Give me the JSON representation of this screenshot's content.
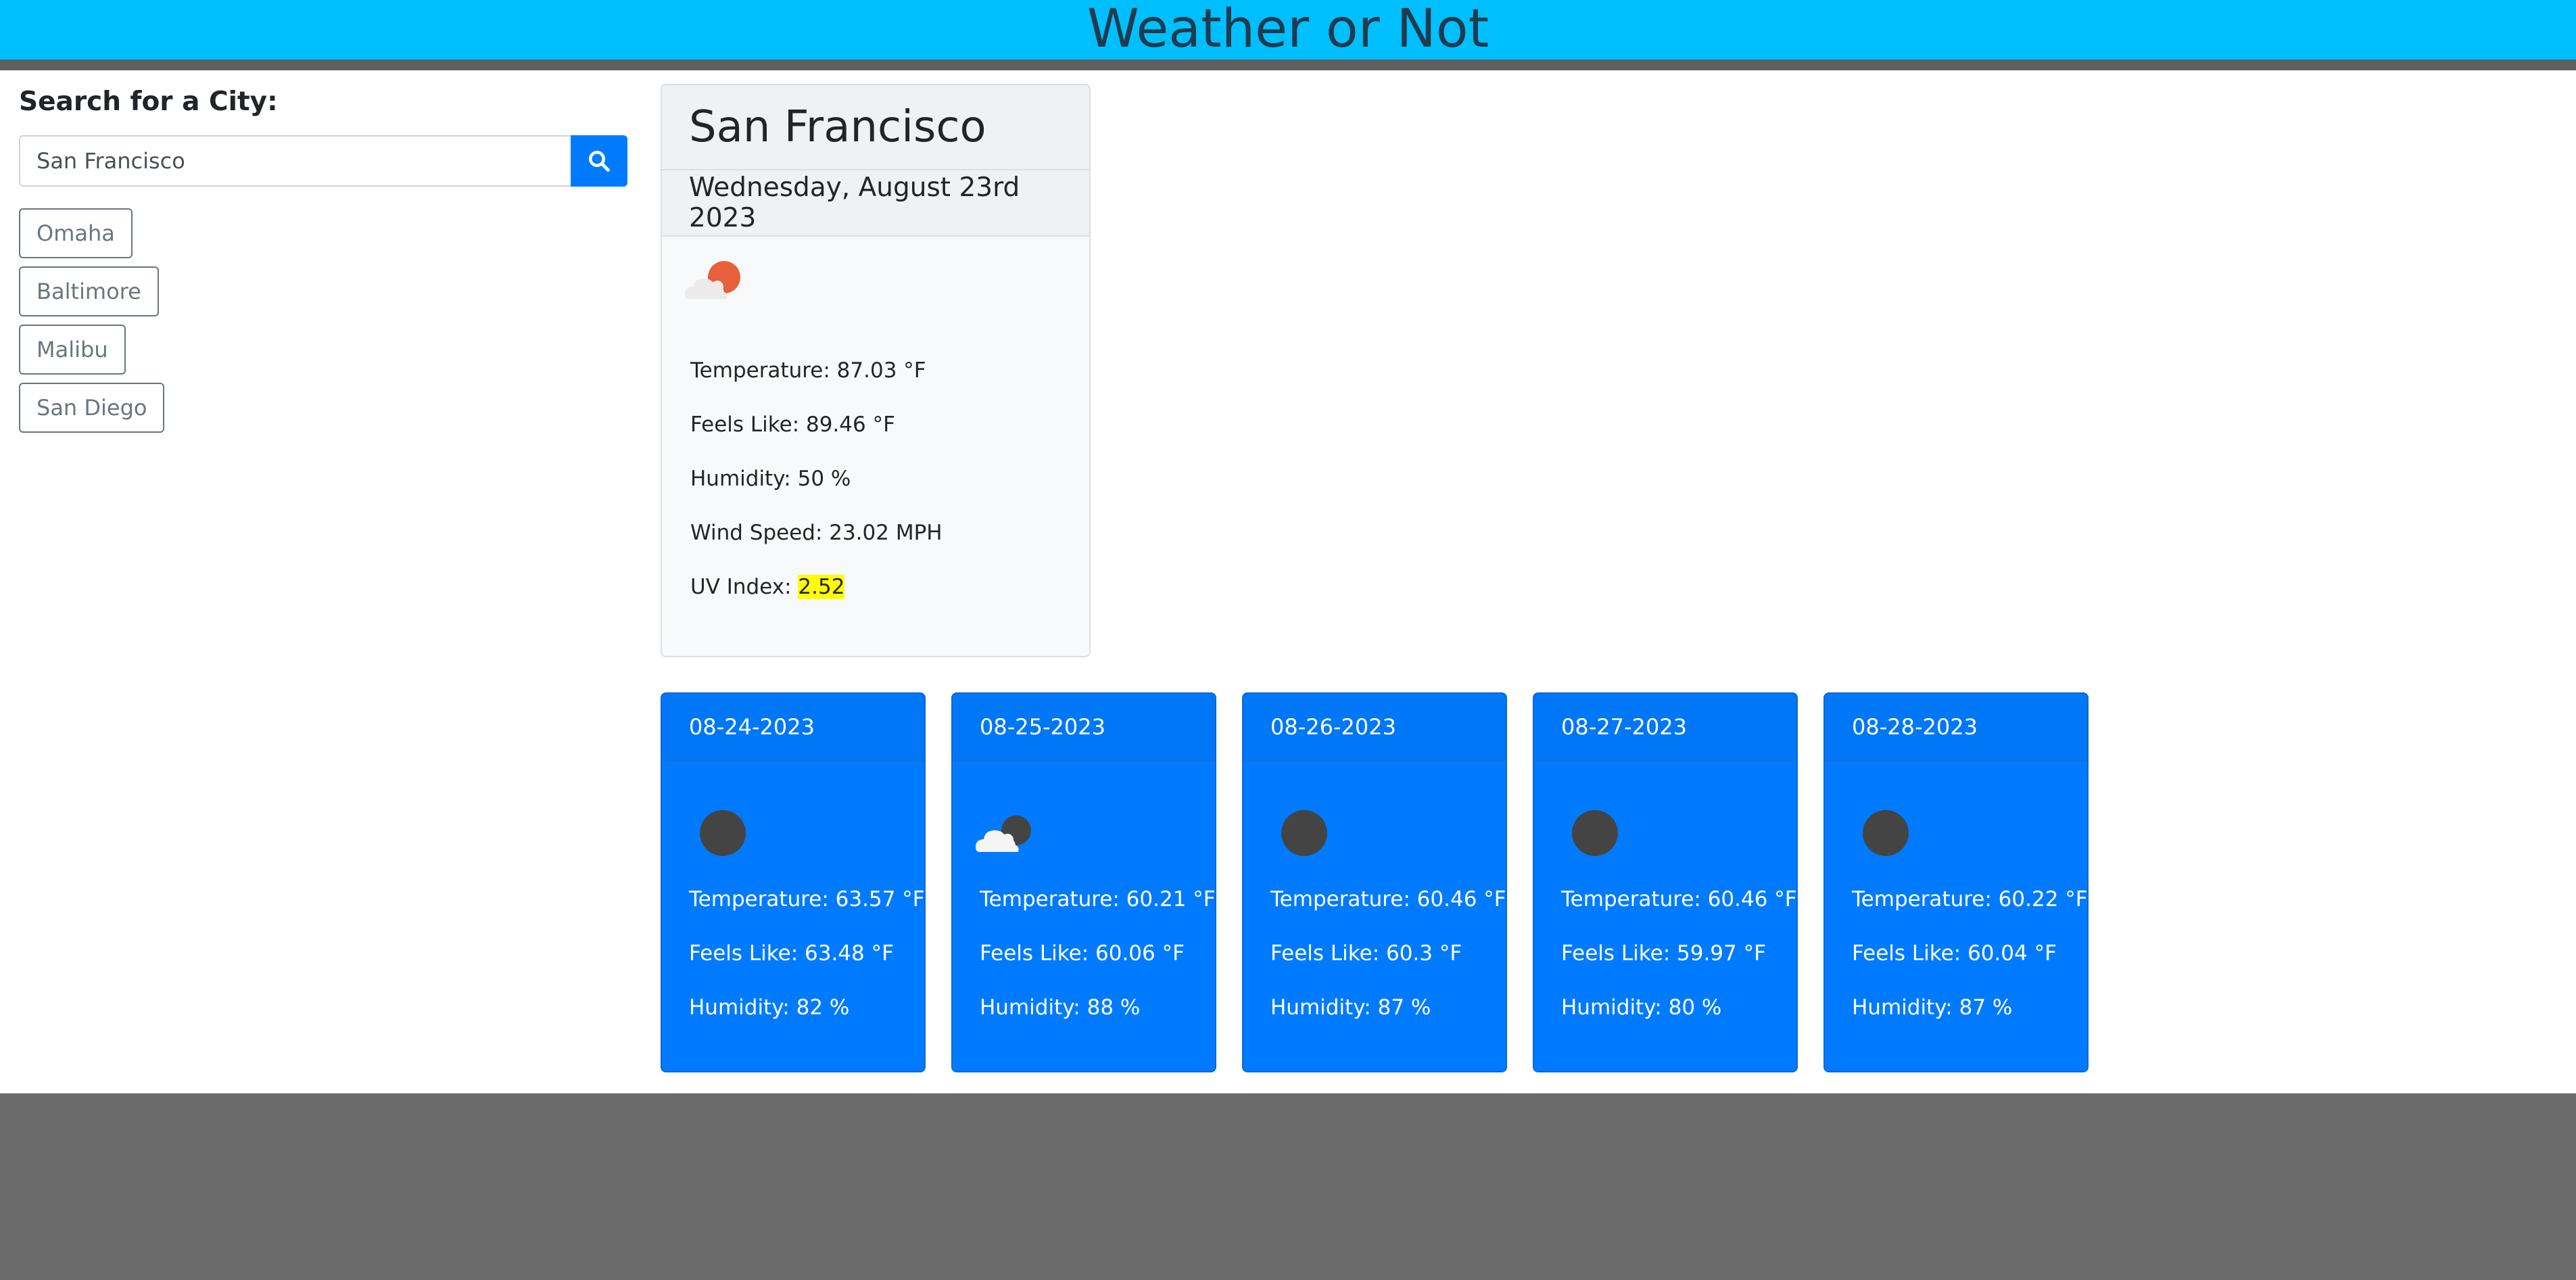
{
  "header": {
    "title": "Weather or Not"
  },
  "search": {
    "heading": "Search for a City:",
    "input_value": "San Francisco",
    "button_icon": "search-icon"
  },
  "history": {
    "cities": [
      "Omaha",
      "Baltimore",
      "Malibu",
      "San Diego"
    ]
  },
  "current": {
    "city": "San Francisco",
    "date": "Wednesday, August 23rd 2023",
    "icon": "few-clouds-sun-icon",
    "temperature": "Temperature: 87.03 °F",
    "feels_like": "Feels Like: 89.46 °F",
    "humidity": "Humidity: 50 %",
    "wind_speed": "Wind Speed: 23.02 MPH",
    "uv_label": "UV Index: ",
    "uv_value": "2.52",
    "uv_color": "#ffff00"
  },
  "forecast": [
    {
      "date": "08-24-2023",
      "icon": "clear-night-icon",
      "temperature": "Temperature: 63.57 °F",
      "feels_like": "Feels Like: 63.48 °F",
      "humidity": "Humidity: 82 %"
    },
    {
      "date": "08-25-2023",
      "icon": "few-clouds-night-icon",
      "temperature": "Temperature: 60.21 °F",
      "feels_like": "Feels Like: 60.06 °F",
      "humidity": "Humidity: 88 %"
    },
    {
      "date": "08-26-2023",
      "icon": "clear-night-icon",
      "temperature": "Temperature: 60.46 °F",
      "feels_like": "Feels Like: 60.3 °F",
      "humidity": "Humidity: 87 %"
    },
    {
      "date": "08-27-2023",
      "icon": "clear-night-icon",
      "temperature": "Temperature: 60.46 °F",
      "feels_like": "Feels Like: 59.97 °F",
      "humidity": "Humidity: 80 %"
    },
    {
      "date": "08-28-2023",
      "icon": "clear-night-icon",
      "temperature": "Temperature: 60.22 °F",
      "feels_like": "Feels Like: 60.04 °F",
      "humidity": "Humidity: 87 %"
    }
  ],
  "colors": {
    "header_bg": "#00bfff",
    "accent": "#007bff",
    "footer_bg": "#6b6b6b"
  }
}
